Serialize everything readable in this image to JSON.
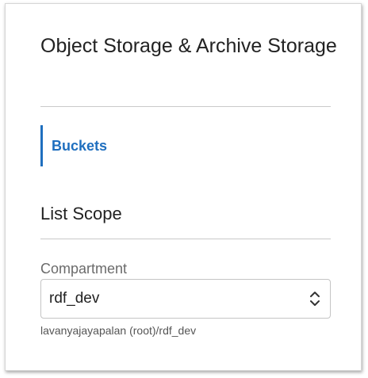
{
  "panel": {
    "title": "Object Storage & Archive Storage"
  },
  "nav": {
    "items": [
      {
        "label": "Buckets",
        "active": true
      }
    ]
  },
  "list_scope": {
    "title": "List Scope",
    "compartment": {
      "label": "Compartment",
      "value": "rdf_dev",
      "helper": "lavanyajayapalan (root)/rdf_dev"
    }
  },
  "colors": {
    "accent": "#1f6fbf",
    "text": "#222222",
    "muted": "#6b6b6b"
  }
}
